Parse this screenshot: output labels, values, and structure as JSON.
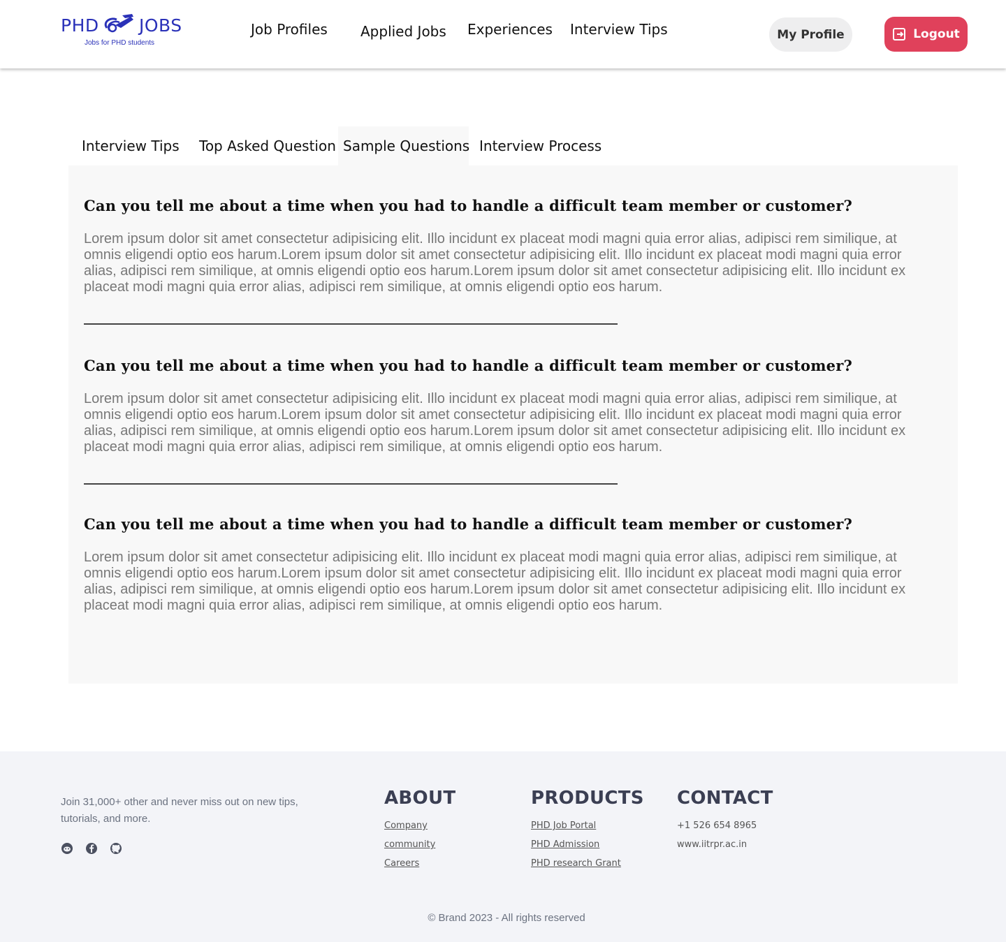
{
  "brand": {
    "left": "PHD",
    "right": "JOBS",
    "tagline": "Jobs for PHD students",
    "color": "#2a31b8"
  },
  "nav": {
    "links": [
      "Job Profiles",
      "Applied Jobs",
      "Experiences",
      "Interview Tips"
    ],
    "profile_label": "My Profile",
    "logout_label": "Logout",
    "logout_color": "#e0415b"
  },
  "tabs": {
    "items": [
      "Interview Tips",
      "Top Asked Question",
      "Sample Questions",
      "Interview Process"
    ],
    "active": "Sample Questions"
  },
  "questions": [
    {
      "title": "Can you tell me about a time when you had to handle a difficult team member or customer?",
      "body": "Lorem ipsum dolor sit amet consectetur adipisicing elit. Illo incidunt ex placeat modi magni quia error alias, adipisci rem similique, at omnis eligendi optio eos harum.Lorem ipsum dolor sit amet consectetur adipisicing elit. Illo incidunt ex placeat modi magni quia error alias, adipisci rem similique, at omnis eligendi optio eos harum.Lorem ipsum dolor sit amet consectetur adipisicing elit. Illo incidunt ex placeat modi magni quia error alias, adipisci rem similique, at omnis eligendi optio eos harum."
    },
    {
      "title": "Can you tell me about a time when you had to handle a difficult team member or customer?",
      "body": "Lorem ipsum dolor sit amet consectetur adipisicing elit. Illo incidunt ex placeat modi magni quia error alias, adipisci rem similique, at omnis eligendi optio eos harum.Lorem ipsum dolor sit amet consectetur adipisicing elit. Illo incidunt ex placeat modi magni quia error alias, adipisci rem similique, at omnis eligendi optio eos harum.Lorem ipsum dolor sit amet consectetur adipisicing elit. Illo incidunt ex placeat modi magni quia error alias, adipisci rem similique, at omnis eligendi optio eos harum."
    },
    {
      "title": "Can you tell me about a time when you had to handle a difficult team member or customer?",
      "body": "Lorem ipsum dolor sit amet consectetur adipisicing elit. Illo incidunt ex placeat modi magni quia error alias, adipisci rem similique, at omnis eligendi optio eos harum.Lorem ipsum dolor sit amet consectetur adipisicing elit. Illo incidunt ex placeat modi magni quia error alias, adipisci rem similique, at omnis eligendi optio eos harum.Lorem ipsum dolor sit amet consectetur adipisicing elit. Illo incidunt ex placeat modi magni quia error alias, adipisci rem similique, at omnis eligendi optio eos harum."
    }
  ],
  "footer": {
    "newsletter": "Join 31,000+ other and never miss out on new tips, tutorials, and more.",
    "socials": [
      "reddit-icon",
      "facebook-icon",
      "github-icon"
    ],
    "about": {
      "heading": "ABOUT",
      "links": [
        "Company",
        "community",
        "Careers"
      ]
    },
    "products": {
      "heading": "PRODUCTS",
      "links": [
        "PHD Job Portal",
        "PHD Admission",
        "PHD research Grant"
      ]
    },
    "contact": {
      "heading": "CONTACT",
      "items": [
        "+1 526 654 8965",
        "www.iitrpr.ac.in"
      ]
    },
    "copyright": "© Brand 2023 - All rights reserved"
  }
}
